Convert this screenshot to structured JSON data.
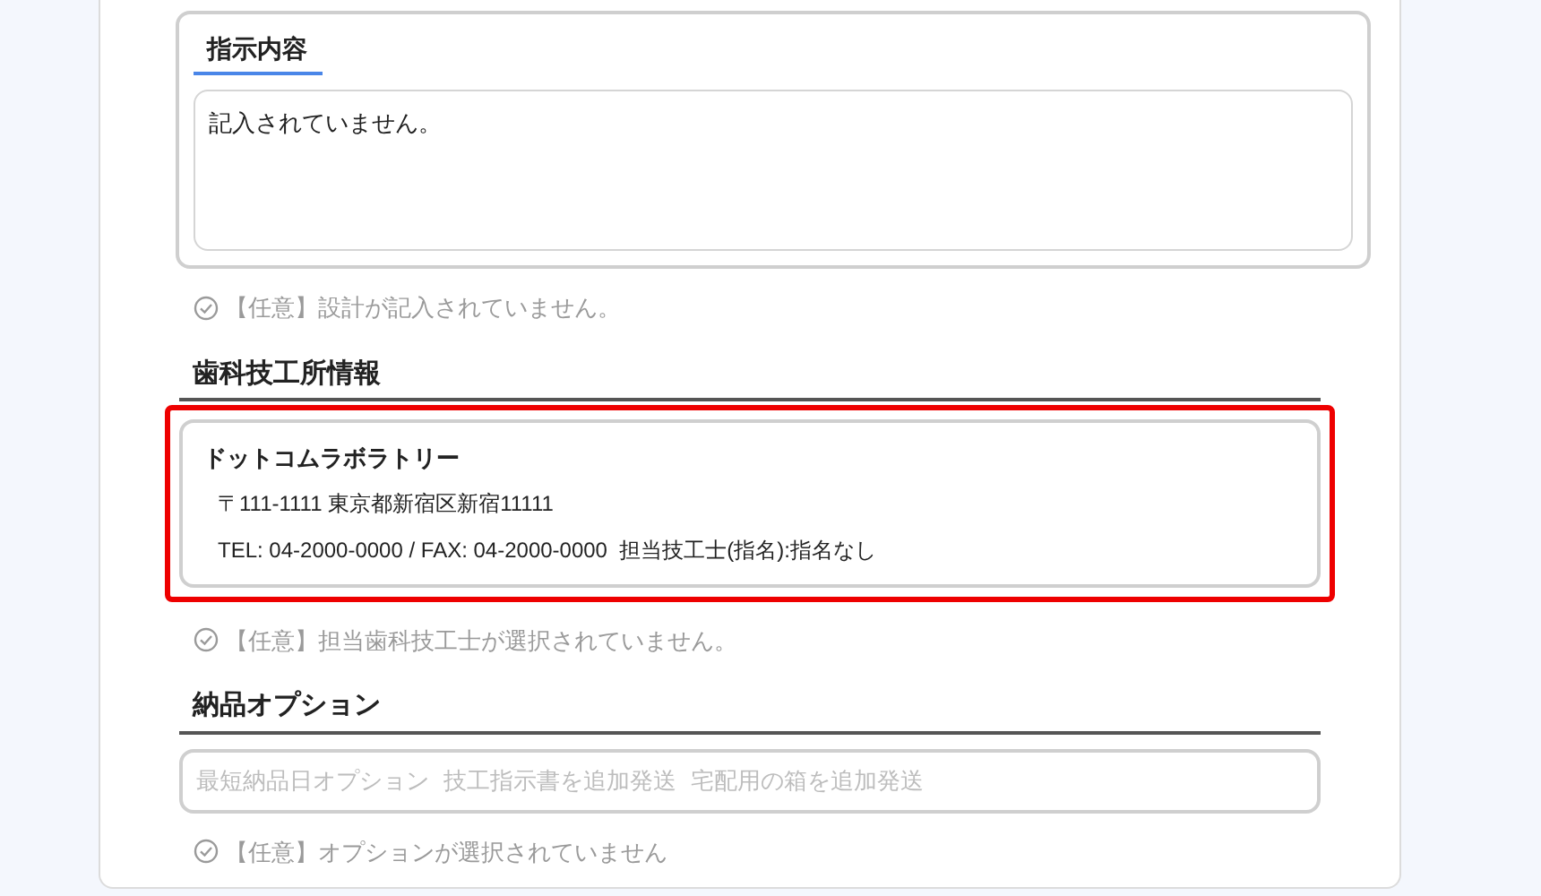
{
  "instruction_panel": {
    "title": "指示内容",
    "value": "記入されていません。"
  },
  "instruction_status": {
    "text": "【任意】設計が記入されていません。",
    "checked": false
  },
  "lab_section": {
    "title": "歯科技工所情報",
    "highlighted": true,
    "name": "ドットコムラボラトリー",
    "address": "〒111-1111 東京都新宿区新宿11111",
    "contact": "TEL: 04-2000-0000 / FAX: 04-2000-0000  担当技工士(指名):指名なし"
  },
  "lab_status": {
    "text": "【任意】担当歯科技工士が選択されていません。",
    "checked": false
  },
  "delivery_section": {
    "title": "納品オプション",
    "options": [
      {
        "label": "最短納品日オプション",
        "selected": false
      },
      {
        "label": "技工指示書を追加発送",
        "selected": false
      },
      {
        "label": "宅配用の箱を追加発送",
        "selected": false
      }
    ]
  },
  "delivery_status": {
    "text": "【任意】オプションが選択されていません",
    "checked": false
  }
}
